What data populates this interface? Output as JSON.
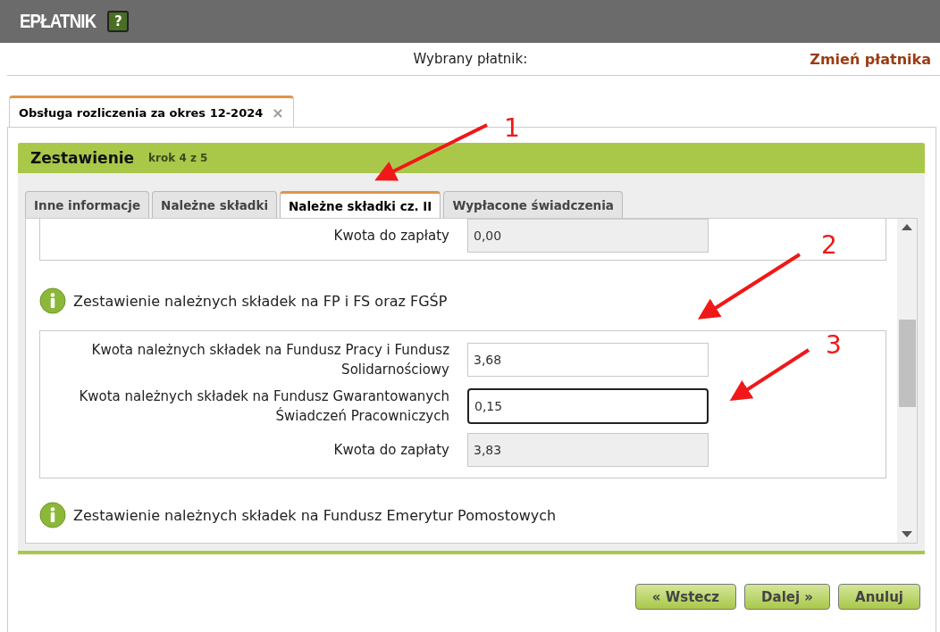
{
  "app": {
    "title": "EPŁATNIK",
    "help": "?"
  },
  "payer": {
    "label": "Wybrany płatnik:",
    "change_link": "Zmień płatnika"
  },
  "document_tabs": [
    {
      "label": "Obsługa rozliczenia za okres 12-2024",
      "selected": true,
      "close": "×"
    }
  ],
  "wizard": {
    "title": "Zestawienie",
    "step": "krok 4 z 5"
  },
  "tabs": [
    {
      "label": "Inne informacje",
      "selected": false
    },
    {
      "label": "Należne składki",
      "selected": false
    },
    {
      "label": "Należne składki cz. II",
      "selected": true
    },
    {
      "label": "Wypłacone świadczenia",
      "selected": false
    }
  ],
  "sections": [
    {
      "fields": [
        {
          "label": "Kwota do zapłaty",
          "value": "0,00",
          "disabled": true,
          "focused": false
        }
      ]
    },
    {
      "heading": "Zestawienie należnych składek na FP i FS oraz FGŚP",
      "fields": [
        {
          "label": "Kwota należnych składek na Fundusz Pracy i Fundusz Solidarnościowy",
          "value": "3,68",
          "disabled": false,
          "focused": false
        },
        {
          "label": "Kwota należnych składek na Fundusz Gwarantowanych Świadczeń Pracowniczych",
          "value": "0,15",
          "disabled": false,
          "focused": true
        },
        {
          "label": "Kwota do zapłaty",
          "value": "3,83",
          "disabled": true,
          "focused": false
        }
      ]
    },
    {
      "heading": "Zestawienie należnych składek na Fundusz Emerytur Pomostowych"
    }
  ],
  "buttons": [
    {
      "label": "« Wstecz"
    },
    {
      "label": "Dalej »"
    },
    {
      "label": "Anuluj"
    }
  ],
  "annotations": [
    {
      "label": "1"
    },
    {
      "label": "2"
    },
    {
      "label": "3"
    }
  ]
}
